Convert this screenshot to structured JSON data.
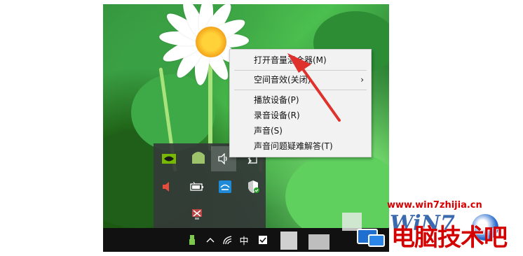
{
  "context_menu": {
    "items": [
      {
        "label": "打开音量混合器(M)"
      },
      {
        "label": "空间音效(关闭)",
        "has_submenu": true
      },
      {
        "label": "播放设备(P)"
      },
      {
        "label": "录音设备(R)"
      },
      {
        "label": "声音(S)"
      },
      {
        "label": "声音问题疑难解答(T)"
      }
    ],
    "submenu_arrow": "›"
  },
  "tray_overflow": {
    "icons": [
      "nvidia-icon",
      "app-icon",
      "volume-icon",
      "device-icon",
      "muted-speaker-icon",
      "battery-icon",
      "network-app-icon",
      "shield-icon",
      "disconnected-icon"
    ]
  },
  "taskbar": {
    "ime_label": "中",
    "icons": [
      "usb-icon",
      "chevron-up-icon",
      "wifi-icon",
      "ime-icon",
      "action-center-icon"
    ]
  },
  "watermark": {
    "url": "www.win7zhijia.cn",
    "brand": "电脑技术吧",
    "logo_text": "WiN7"
  },
  "colors": {
    "menu_bg": "#f2f2f2",
    "tray_bg": "#343a38",
    "taskbar_bg": "#111111",
    "arrow_red": "#e0322d",
    "watermark_red": "#d60000"
  }
}
